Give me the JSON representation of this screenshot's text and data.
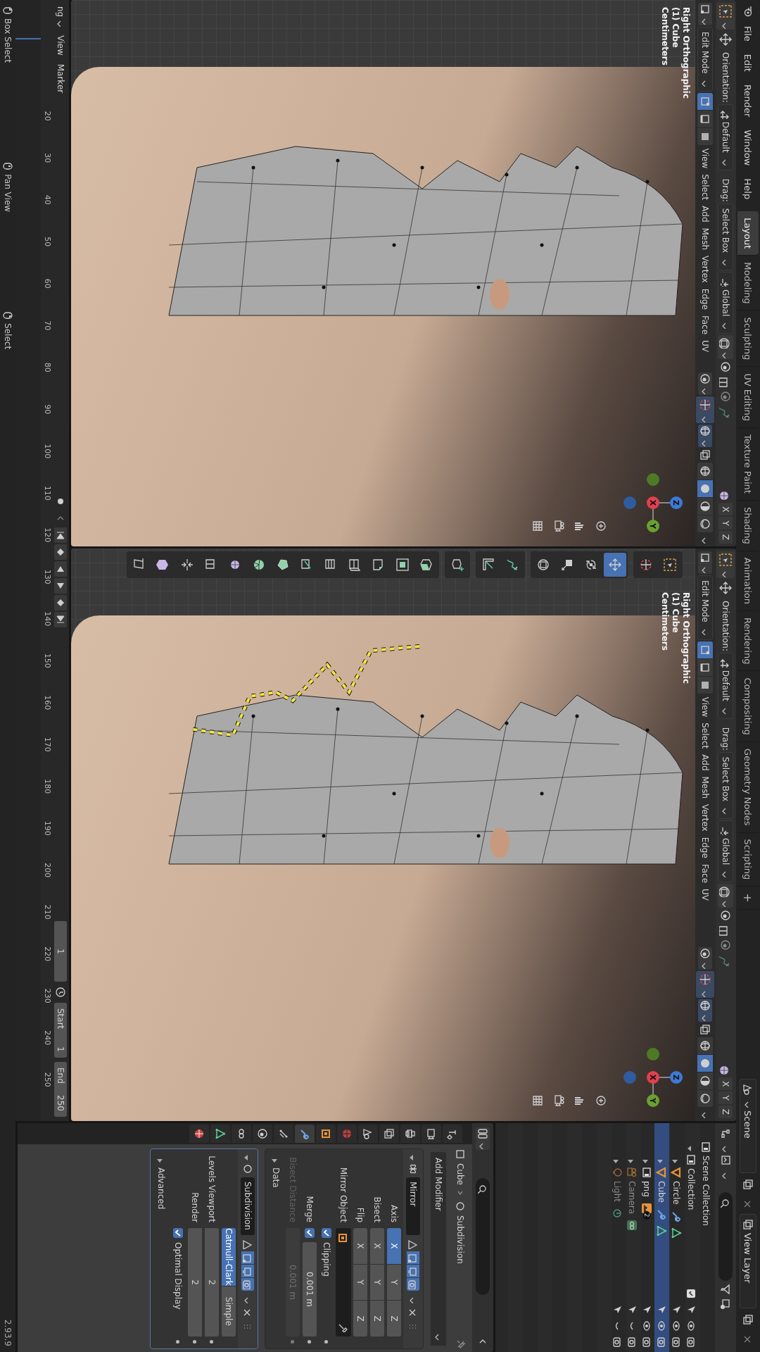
{
  "top_bar": {
    "menus": [
      "File",
      "Edit",
      "Render",
      "Window",
      "Help"
    ],
    "workspaces": [
      {
        "label": "Layout",
        "selected": true
      },
      {
        "label": "Modeling",
        "selected": false
      },
      {
        "label": "Sculpting",
        "selected": false
      },
      {
        "label": "UV Editing",
        "selected": false
      },
      {
        "label": "Texture Paint",
        "selected": false
      },
      {
        "label": "Shading",
        "selected": false
      },
      {
        "label": "Animation",
        "selected": false
      },
      {
        "label": "Rendering",
        "selected": false
      },
      {
        "label": "Compositing",
        "selected": false
      },
      {
        "label": "Geometry Nodes",
        "selected": false
      },
      {
        "label": "Scripting",
        "selected": false
      }
    ],
    "add_workspace": "+",
    "scene": "Scene",
    "view_layer": "View Layer"
  },
  "viewports": [
    {
      "tool_header": {
        "orientation_label": "Orientation:",
        "orientation": "Default",
        "drag_label": "Drag:",
        "drag": "Select Box",
        "transform": "Global",
        "mirror_axes": [
          "X",
          "Y",
          "Z"
        ]
      },
      "header": {
        "mode": "Edit Mode",
        "select_modes": [
          {
            "kind": "vertex",
            "selected": true
          },
          {
            "kind": "edge",
            "selected": false
          },
          {
            "kind": "face",
            "selected": false
          }
        ],
        "menus": [
          "View",
          "Select",
          "Add",
          "Mesh",
          "Vertex",
          "Edge",
          "Face",
          "UV"
        ],
        "shading": [
          {
            "kind": "wireframe",
            "selected": false
          },
          {
            "kind": "solid",
            "selected": true
          },
          {
            "kind": "material",
            "selected": false
          },
          {
            "kind": "rendered",
            "selected": false
          }
        ]
      },
      "info": [
        "Right Orthographic",
        "(1) Cube",
        "Centimeters"
      ],
      "gizmo": {
        "up": "Z",
        "center": "X",
        "right": "Y"
      },
      "annotation": false
    },
    {
      "tool_header": {
        "orientation_label": "Orientation:",
        "orientation": "Default",
        "drag_label": "Drag:",
        "drag": "Select Box",
        "transform": "Global",
        "mirror_axes": [
          "X",
          "Y",
          "Z"
        ]
      },
      "header": {
        "mode": "Edit Mode",
        "select_modes": [
          {
            "kind": "vertex",
            "selected": true
          },
          {
            "kind": "edge",
            "selected": false
          },
          {
            "kind": "face",
            "selected": false
          }
        ],
        "menus": [
          "View",
          "Select",
          "Add",
          "Mesh",
          "Vertex",
          "Edge",
          "Face",
          "UV"
        ],
        "shading": [
          {
            "kind": "wireframe",
            "selected": false
          },
          {
            "kind": "solid",
            "selected": true
          },
          {
            "kind": "material",
            "selected": false
          },
          {
            "kind": "rendered",
            "selected": false
          }
        ]
      },
      "info": [
        "Right Orthographic",
        "(1) Cube",
        "Centimeters"
      ],
      "gizmo": {
        "up": "Z",
        "center": "X",
        "right": "Y"
      },
      "annotation": true,
      "toolbar": [
        [
          {
            "kind": "select_box",
            "selected": false
          },
          {
            "kind": "cursor",
            "selected": false
          }
        ],
        [
          {
            "kind": "move",
            "selected": true
          },
          {
            "kind": "rotate",
            "selected": false
          },
          {
            "kind": "scale",
            "selected": false
          },
          {
            "kind": "transform",
            "selected": false
          }
        ],
        [
          {
            "kind": "annotate",
            "selected": false
          },
          {
            "kind": "measure",
            "selected": false
          }
        ],
        [
          {
            "kind": "add_cube",
            "selected": false
          }
        ],
        [
          {
            "kind": "extrude",
            "selected": false
          },
          {
            "kind": "inset",
            "selected": false
          },
          {
            "kind": "bevel",
            "selected": false
          },
          {
            "kind": "loop_cut",
            "selected": false
          },
          {
            "kind": "offset_loop",
            "selected": false
          },
          {
            "kind": "knife",
            "selected": false
          },
          {
            "kind": "poly_build",
            "selected": false
          },
          {
            "kind": "spin",
            "selected": false
          },
          {
            "kind": "smooth",
            "selected": false
          },
          {
            "kind": "edge_slide",
            "selected": false
          },
          {
            "kind": "shrink",
            "selected": false
          },
          {
            "kind": "push_pull",
            "selected": false
          },
          {
            "kind": "shear",
            "selected": false
          }
        ]
      ]
    }
  ],
  "timeline": {
    "menus": [
      "ng",
      "View",
      "Marker"
    ],
    "ticks": [
      "20",
      "30",
      "40",
      "50",
      "60",
      "70",
      "80",
      "90",
      "100",
      "110",
      "120",
      "130",
      "140",
      "150",
      "160",
      "170",
      "180",
      "190",
      "200",
      "210",
      "220",
      "230",
      "240",
      "250"
    ],
    "current_frame": "1",
    "start_label": "Start",
    "start": "1",
    "end_label": "End",
    "end": "250"
  },
  "outliner": {
    "items": [
      {
        "label": "Scene Collection",
        "kind": "scene_collection",
        "children": [
          {
            "label": "Collection",
            "kind": "collection",
            "expanded": true,
            "children": [
              {
                "label": "Circle",
                "kind": "mesh",
                "expanded": false,
                "selected": false,
                "visible": true
              },
              {
                "label": "Cube",
                "kind": "mesh",
                "expanded": false,
                "selected": true,
                "visible": true
              },
              {
                "label": "png",
                "kind": "image",
                "badge": "2",
                "expanded": false,
                "selected": false,
                "visible": true
              },
              {
                "label": "Camera",
                "kind": "camera",
                "expanded": false,
                "selected": false,
                "visible": false
              },
              {
                "label": "Light",
                "kind": "light",
                "expanded": false,
                "selected": false,
                "visible": false
              }
            ]
          }
        ]
      }
    ]
  },
  "properties": {
    "tabs": [
      {
        "kind": "tool",
        "selected": false
      },
      {
        "kind": "render",
        "selected": false
      },
      {
        "kind": "output",
        "selected": false
      },
      {
        "kind": "view_layer",
        "selected": false
      },
      {
        "kind": "scene",
        "selected": false
      },
      {
        "kind": "world",
        "selected": false
      },
      {
        "kind": "object",
        "selected": false
      },
      {
        "kind": "modifier",
        "selected": true
      },
      {
        "kind": "particles",
        "selected": false
      },
      {
        "kind": "physics",
        "selected": false
      },
      {
        "kind": "constraints",
        "selected": false
      },
      {
        "kind": "data",
        "selected": false
      },
      {
        "kind": "material",
        "selected": false
      }
    ],
    "breadcrumb": [
      "Cube",
      "Subdivision"
    ],
    "add_modifier": "Add Modifier",
    "modifiers": [
      {
        "kind": "mirror",
        "name": "Mirror",
        "expanded": true,
        "toggles": [
          {
            "kind": "on_cage",
            "on": false
          },
          {
            "kind": "edit_mode",
            "on": true
          },
          {
            "kind": "viewport",
            "on": true
          },
          {
            "kind": "render",
            "on": true
          }
        ],
        "axis_rows": [
          {
            "label": "Axis",
            "toggles": [
              {
                "label": "X",
                "selected": true
              },
              {
                "label": "Y",
                "selected": false
              },
              {
                "label": "Z",
                "selected": false
              }
            ]
          },
          {
            "label": "Bisect",
            "toggles": [
              {
                "label": "X",
                "selected": false
              },
              {
                "label": "Y",
                "selected": false
              },
              {
                "label": "Z",
                "selected": false
              }
            ]
          },
          {
            "label": "Flip",
            "toggles": [
              {
                "label": "X",
                "selected": false
              },
              {
                "label": "Y",
                "selected": false
              },
              {
                "label": "Z",
                "selected": false
              }
            ]
          }
        ],
        "mirror_object_label": "Mirror Object",
        "clipping": {
          "label": "Clipping",
          "checked": true
        },
        "merge": {
          "label": "Merge",
          "checked": true,
          "value": "0.001 m"
        },
        "bisect_distance": {
          "label": "Bisect Distance",
          "value": "0.001 m",
          "disabled": true
        },
        "subpanel": {
          "label": "Data",
          "expanded": false
        }
      },
      {
        "kind": "subdivision",
        "name": "Subdivision",
        "expanded": true,
        "toggles": [
          {
            "kind": "on_cage",
            "on": false
          },
          {
            "kind": "edit_mode",
            "on": true
          },
          {
            "kind": "viewport",
            "on": true
          },
          {
            "kind": "render",
            "on": true
          }
        ],
        "types": [
          {
            "label": "Catmull-Clark",
            "selected": true
          },
          {
            "label": "Simple",
            "selected": false
          }
        ],
        "levels_viewport": {
          "label": "Levels Viewport",
          "value": "2"
        },
        "render": {
          "label": "Render",
          "value": "2"
        },
        "optimal_display": {
          "label": "Optimal Display",
          "checked": true
        },
        "subpanel": {
          "label": "Advanced",
          "expanded": false
        }
      }
    ]
  },
  "status_bar": {
    "hints": [
      "Box Select",
      "Pan View",
      "Select"
    ],
    "version": "2.93.9"
  }
}
